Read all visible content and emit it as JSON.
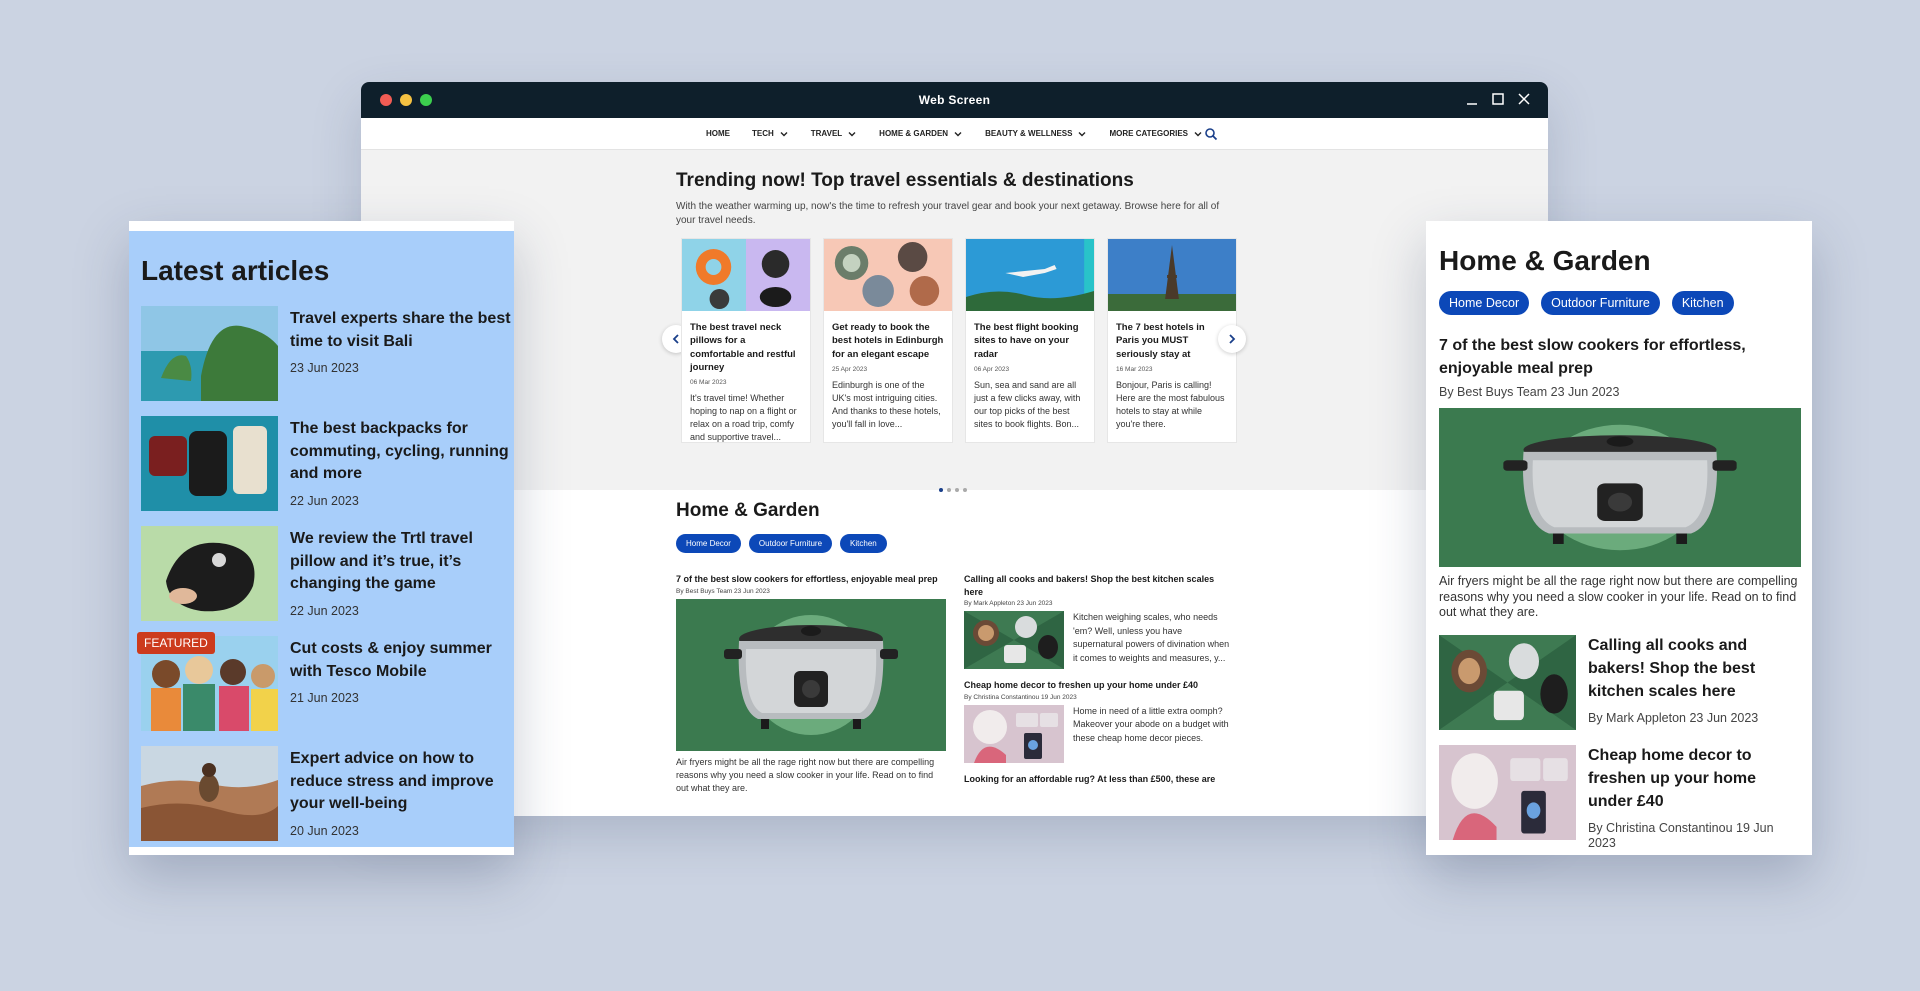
{
  "window": {
    "title": "Web Screen",
    "controls": [
      "minimize-icon",
      "maximize-icon",
      "close-icon"
    ],
    "dot_colors": [
      "#f25c54",
      "#f5c242",
      "#3ccf4e"
    ]
  },
  "nav": {
    "items": [
      {
        "label": "HOME",
        "has_dropdown": false
      },
      {
        "label": "TECH",
        "has_dropdown": true
      },
      {
        "label": "TRAVEL",
        "has_dropdown": true
      },
      {
        "label": "HOME & GARDEN",
        "has_dropdown": true
      },
      {
        "label": "BEAUTY & WELLNESS",
        "has_dropdown": true
      },
      {
        "label": "MORE CATEGORIES",
        "has_dropdown": true
      }
    ],
    "search_icon": "search-icon"
  },
  "trending": {
    "title": "Trending now! Top travel essentials & destinations",
    "subtitle": "With the weather warming up, now's the time to refresh your travel gear and book your next getaway. Browse here for all of your travel needs.",
    "cards": [
      {
        "title": "The best travel neck pillows for a comfortable and restful journey",
        "date": "06 Mar 2023",
        "text": "It's travel time! Whether hoping to nap on a flight or relax on a road trip, comfy and supportive travel..."
      },
      {
        "title": "Get ready to book the best hotels in Edinburgh for an elegant escape",
        "date": "25 Apr 2023",
        "text": "Edinburgh is one of the UK's most intriguing cities. And thanks to these hotels, you'll fall in love..."
      },
      {
        "title": "The best flight booking sites to have on your radar",
        "date": "06 Apr 2023",
        "text": "Sun, sea and sand are all just a few clicks away, with our top picks of the best sites to book flights. Bon..."
      },
      {
        "title": "The 7 best hotels in Paris you MUST seriously stay at",
        "date": "16 Mar 2023",
        "text": "Bonjour, Paris is calling! Here are the most fabulous hotels to stay at while you're there."
      }
    ],
    "carousel_pages": 4,
    "carousel_active": 1
  },
  "home_garden": {
    "title": "Home & Garden",
    "pills": [
      "Home Decor",
      "Outdoor Furniture",
      "Kitchen"
    ],
    "main": {
      "title": "7 of the best slow cookers for effortless, enjoyable meal prep",
      "by": "By Best Buys Team 23 Jun 2023",
      "text": "Air fryers might be all the rage right now but there are compelling reasons why you need a slow cooker in your life. Read on to find out what they are."
    },
    "side": [
      {
        "title": "Calling all cooks and bakers! Shop the best kitchen scales here",
        "by": "By Mark Appleton 23 Jun 2023",
        "text": "Kitchen weighing scales, who needs 'em? Well, unless you have supernatural powers of divination when it comes to weights and measures, y..."
      },
      {
        "title": "Cheap home decor to freshen up your home under £40",
        "by": "By Christina Constantinou 19 Jun 2023",
        "text": "Home in need of a little extra oomph? Makeover your abode on a budget with these cheap home decor pieces."
      },
      {
        "title": "Looking for an affordable rug? At less than £500, these are"
      }
    ]
  },
  "latest": {
    "title": "Latest articles",
    "items": [
      {
        "title": "Travel experts share the best time to visit Bali",
        "date": "23 Jun 2023",
        "badge": ""
      },
      {
        "title": "The best backpacks for commuting, cycling, running and more",
        "date": "22 Jun 2023",
        "badge": ""
      },
      {
        "title": "We review the Trtl travel pillow and it’s true, it’s changing the game",
        "date": "22 Jun 2023",
        "badge": ""
      },
      {
        "title": "Cut costs & enjoy summer with Tesco Mobile",
        "date": "21 Jun 2023",
        "badge": "FEATURED"
      },
      {
        "title": "Expert advice on how to reduce stress and improve your well-being",
        "date": "20 Jun 2023",
        "badge": ""
      }
    ]
  },
  "mobile_hg": {
    "title": "Home & Garden",
    "pills": [
      "Home Decor",
      "Outdoor Furniture",
      "Kitchen"
    ],
    "main": {
      "title": "7 of the best slow cookers for effortless, enjoyable meal prep",
      "by": "By Best Buys Team 23 Jun 2023",
      "text": "Air fryers might be all the rage right now but there are compelling reasons why you need a slow cooker in your life. Read on to find out what they are."
    },
    "items": [
      {
        "title": "Calling all cooks and bakers! Shop the best kitchen scales here",
        "by": "By Mark Appleton 23 Jun 2023"
      },
      {
        "title": "Cheap home decor to freshen up your home under £40",
        "by": "By Christina Constantinou 19 Jun 2023"
      }
    ]
  },
  "colors": {
    "background": "#cbd3e2",
    "titlebar": "#0e1f2b",
    "pill": "#0c48b8",
    "latest_panel": "#a8cefa",
    "featured_badge": "#cc3b1d",
    "slow_cooker_bg": "#3b7a4f"
  }
}
